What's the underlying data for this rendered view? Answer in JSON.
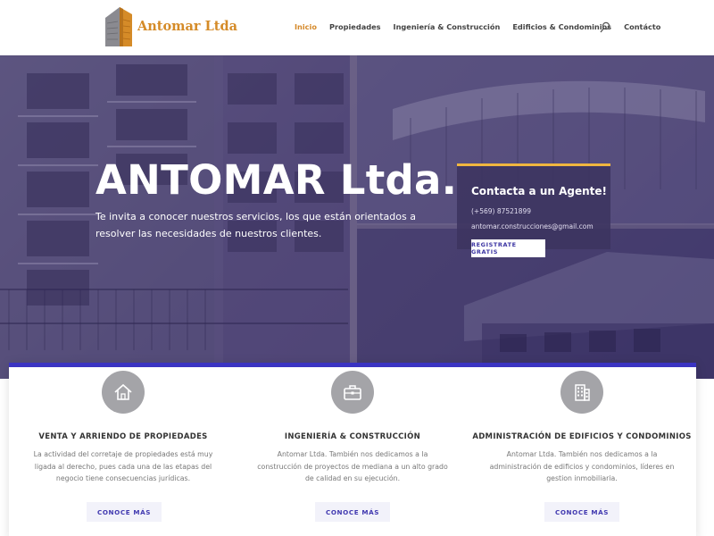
{
  "header": {
    "logo_text": "Antomar Ltda",
    "nav": [
      "Inicio",
      "Propiedades",
      "Ingeniería & Construcción",
      "Edificios & Condominios",
      "Contácto"
    ],
    "active_nav": "Inicio",
    "search_icon": "search-icon"
  },
  "hero": {
    "title": "ANTOMAR Ltda.",
    "text": "Te invita a conocer nuestros servicios, los que están orientados a resolver las necesidades de nuestros clientes."
  },
  "agent_card": {
    "title": "Contacta a un Agente!",
    "phone": "(+569) 87521899",
    "email": "antomar.construcciones@gmail.com",
    "button": "REGISTRATE GRATIS"
  },
  "services": [
    {
      "icon": "home-icon",
      "title": "VENTA Y ARRIENDO DE PROPIEDADES",
      "description": "La actividad del corretaje de propiedades está muy ligada al derecho, pues cada una de las etapas del negocio tiene consecuencias jurídicas.",
      "button": "CONOCE MÁS"
    },
    {
      "icon": "briefcase-icon",
      "title": "INGENIERÍA & CONSTRUCCIÓN",
      "description": "Antomar Ltda. También nos dedicamos a la construcción de proyectos de mediana a un alto grado de calidad en su ejecución.",
      "button": "CONOCE MÁS"
    },
    {
      "icon": "building-icon",
      "title": "ADMINISTRACIÓN DE EDIFICIOS Y CONDOMINIOS",
      "description": "Antomar Ltda. También nos dedicamos a la administración de edificios y condominios, líderes en gestion inmobiliaria.",
      "button": "CONOCE MÁS"
    }
  ],
  "colors": {
    "accent_orange": "#d5892a",
    "accent_blue": "#3b34c2",
    "hero_overlay": "#4a4173",
    "card_border": "#f0b63f"
  }
}
